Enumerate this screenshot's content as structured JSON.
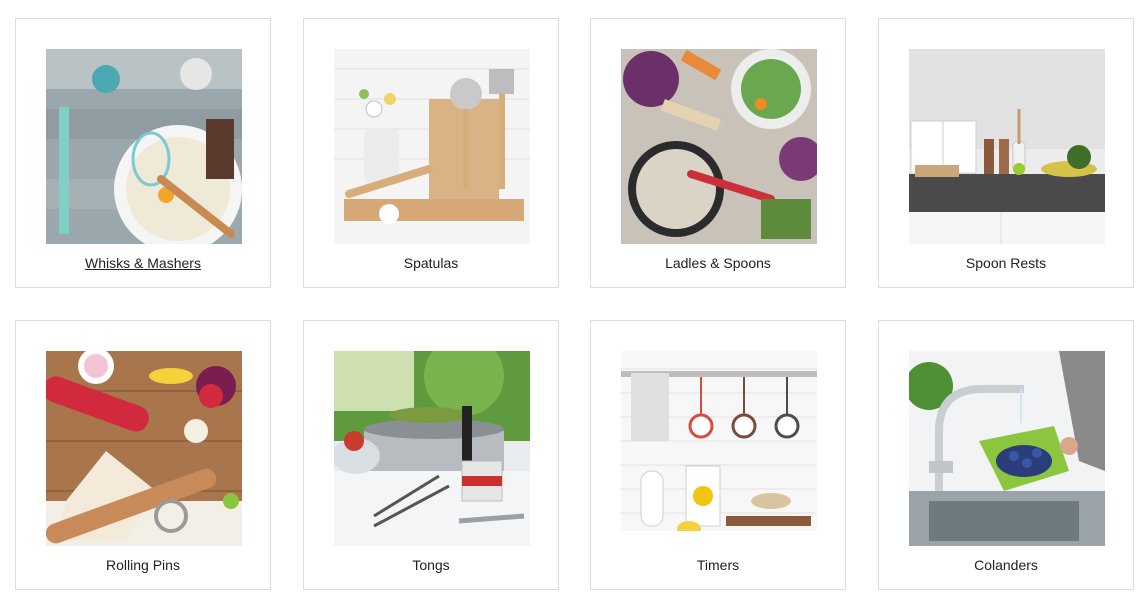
{
  "categories": [
    {
      "label": "Whisks & Mashers",
      "image_icon": "whisk-icon"
    },
    {
      "label": "Spatulas",
      "image_icon": "spatula-icon"
    },
    {
      "label": "Ladles & Spoons",
      "image_icon": "ladle-icon"
    },
    {
      "label": "Spoon Rests",
      "image_icon": "spoon-rest-icon"
    },
    {
      "label": "Rolling Pins",
      "image_icon": "rolling-pin-icon"
    },
    {
      "label": "Tongs",
      "image_icon": "tongs-icon"
    },
    {
      "label": "Timers",
      "image_icon": "timer-icon"
    },
    {
      "label": "Colanders",
      "image_icon": "colander-icon"
    }
  ]
}
